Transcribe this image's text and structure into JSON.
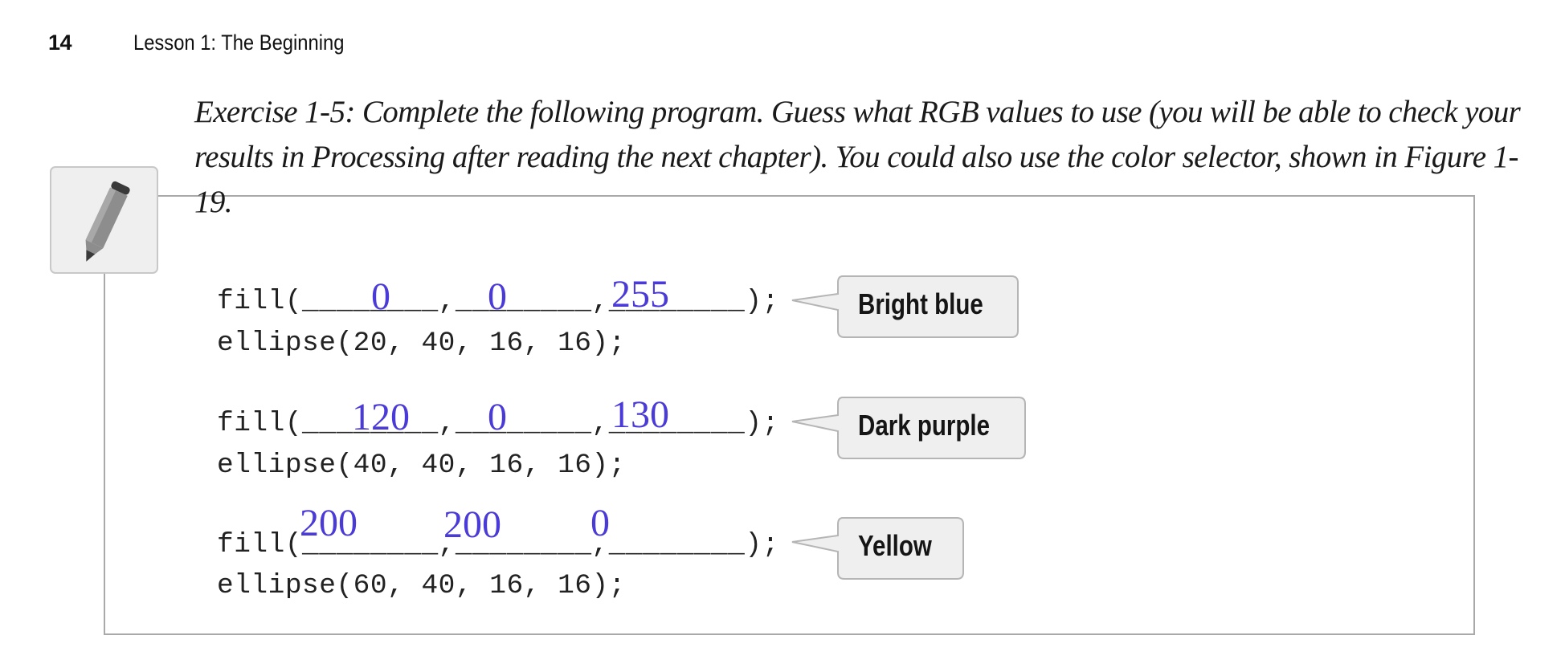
{
  "header": {
    "page_number": "14",
    "running_head": "Lesson 1: The Beginning"
  },
  "exercise": {
    "text": "Exercise 1-5: Complete the following program. Guess what RGB values to use (you will be able to check your results in Processing after reading the next chapter). You could also use the color selector, shown in Figure 1-19.",
    "icon": "pencil-icon"
  },
  "code": {
    "fill_prefix": "fill(",
    "fill_suffix": ");",
    "blank_segment": "________",
    "separator": ",",
    "blocks": [
      {
        "ellipse": "ellipse(20, 40, 16, 16);",
        "answers": [
          "0",
          "0",
          "255"
        ],
        "label": "Bright blue"
      },
      {
        "ellipse": "ellipse(40, 40, 16, 16);",
        "answers": [
          "120",
          "0",
          "130"
        ],
        "label": "Dark purple"
      },
      {
        "ellipse": "ellipse(60, 40, 16, 16);",
        "answers": [
          "200",
          "200",
          "0"
        ],
        "label": "Yellow"
      }
    ]
  },
  "colors": {
    "handwriting": "#4a3ad8",
    "box_border": "#a9a9a9",
    "callout_fill": "#efefef"
  }
}
